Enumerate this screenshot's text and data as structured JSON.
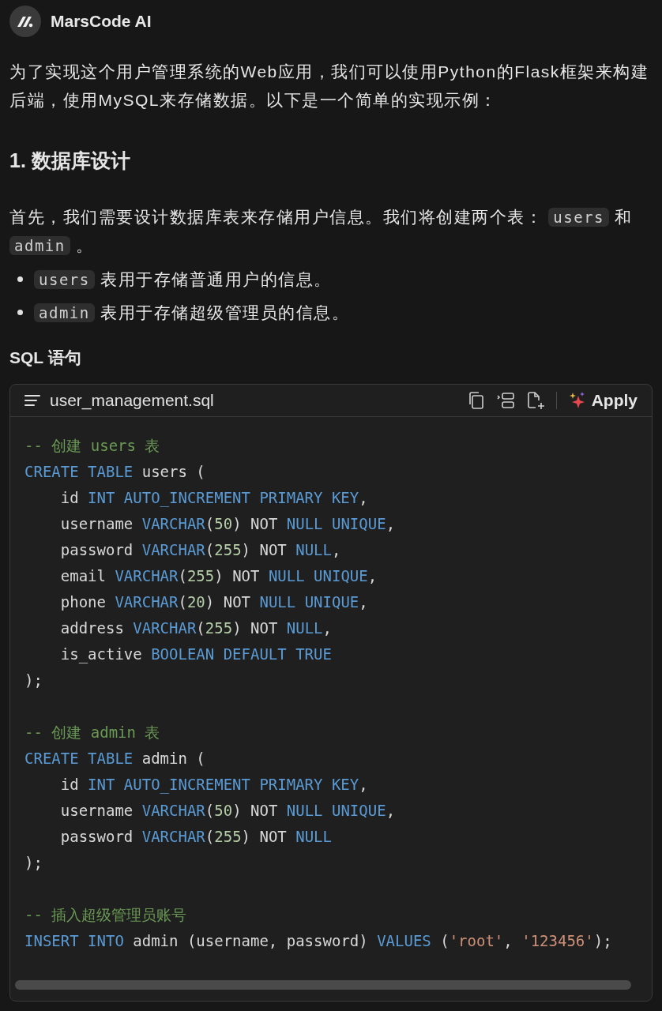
{
  "header": {
    "title": "MarsCode AI"
  },
  "intro": [
    {
      "kind": "text",
      "text": "为了实现这个用户管理系统的Web应用，我们可以使用Python的Flask框架来构建后端，使用MySQL来存储数据。以下是一个简单的实现示例："
    }
  ],
  "heading": "1. 数据库设计",
  "paragraph": [
    {
      "kind": "text",
      "text": "首先，我们需要设计数据库表来存储用户信息。我们将创建两个表： "
    },
    {
      "kind": "code",
      "text": "users"
    },
    {
      "kind": "text",
      "text": " 和 "
    },
    {
      "kind": "code",
      "text": "admin"
    },
    {
      "kind": "text",
      "text": " 。"
    }
  ],
  "bullets": [
    [
      {
        "kind": "code",
        "text": "users"
      },
      {
        "kind": "text",
        "text": " 表用于存储普通用户的信息。"
      }
    ],
    [
      {
        "kind": "code",
        "text": "admin"
      },
      {
        "kind": "text",
        "text": " 表用于存储超级管理员的信息。"
      }
    ]
  ],
  "subheading": "SQL 语句",
  "code_block": {
    "filename": "user_management.sql",
    "apply_label": "Apply",
    "sections": [
      [
        [
          {
            "kind": "comment",
            "text": "-- 创建 users 表"
          }
        ],
        [
          {
            "kind": "kw",
            "text": "CREATE TABLE"
          },
          {
            "kind": "plain",
            "text": " users ("
          }
        ],
        [
          {
            "kind": "plain",
            "text": "    id "
          },
          {
            "kind": "kw",
            "text": "INT AUTO_INCREMENT PRIMARY KEY"
          },
          {
            "kind": "plain",
            "text": ","
          }
        ],
        [
          {
            "kind": "plain",
            "text": "    username "
          },
          {
            "kind": "kw",
            "text": "VARCHAR"
          },
          {
            "kind": "plain",
            "text": "("
          },
          {
            "kind": "num",
            "text": "50"
          },
          {
            "kind": "plain",
            "text": ") NOT "
          },
          {
            "kind": "kw",
            "text": "NULL UNIQUE"
          },
          {
            "kind": "plain",
            "text": ","
          }
        ],
        [
          {
            "kind": "plain",
            "text": "    password "
          },
          {
            "kind": "kw",
            "text": "VARCHAR"
          },
          {
            "kind": "plain",
            "text": "("
          },
          {
            "kind": "num",
            "text": "255"
          },
          {
            "kind": "plain",
            "text": ") NOT "
          },
          {
            "kind": "kw",
            "text": "NULL"
          },
          {
            "kind": "plain",
            "text": ","
          }
        ],
        [
          {
            "kind": "plain",
            "text": "    email "
          },
          {
            "kind": "kw",
            "text": "VARCHAR"
          },
          {
            "kind": "plain",
            "text": "("
          },
          {
            "kind": "num",
            "text": "255"
          },
          {
            "kind": "plain",
            "text": ") NOT "
          },
          {
            "kind": "kw",
            "text": "NULL UNIQUE"
          },
          {
            "kind": "plain",
            "text": ","
          }
        ],
        [
          {
            "kind": "plain",
            "text": "    phone "
          },
          {
            "kind": "kw",
            "text": "VARCHAR"
          },
          {
            "kind": "plain",
            "text": "("
          },
          {
            "kind": "num",
            "text": "20"
          },
          {
            "kind": "plain",
            "text": ") NOT "
          },
          {
            "kind": "kw",
            "text": "NULL UNIQUE"
          },
          {
            "kind": "plain",
            "text": ","
          }
        ],
        [
          {
            "kind": "plain",
            "text": "    address "
          },
          {
            "kind": "kw",
            "text": "VARCHAR"
          },
          {
            "kind": "plain",
            "text": "("
          },
          {
            "kind": "num",
            "text": "255"
          },
          {
            "kind": "plain",
            "text": ") NOT "
          },
          {
            "kind": "kw",
            "text": "NULL"
          },
          {
            "kind": "plain",
            "text": ","
          }
        ],
        [
          {
            "kind": "plain",
            "text": "    is_active "
          },
          {
            "kind": "kw",
            "text": "BOOLEAN DEFAULT TRUE"
          }
        ],
        [
          {
            "kind": "plain",
            "text": ");"
          }
        ]
      ],
      [
        [
          {
            "kind": "comment",
            "text": "-- 创建 admin 表"
          }
        ],
        [
          {
            "kind": "kw",
            "text": "CREATE TABLE"
          },
          {
            "kind": "plain",
            "text": " admin ("
          }
        ],
        [
          {
            "kind": "plain",
            "text": "    id "
          },
          {
            "kind": "kw",
            "text": "INT AUTO_INCREMENT PRIMARY KEY"
          },
          {
            "kind": "plain",
            "text": ","
          }
        ],
        [
          {
            "kind": "plain",
            "text": "    username "
          },
          {
            "kind": "kw",
            "text": "VARCHAR"
          },
          {
            "kind": "plain",
            "text": "("
          },
          {
            "kind": "num",
            "text": "50"
          },
          {
            "kind": "plain",
            "text": ") NOT "
          },
          {
            "kind": "kw",
            "text": "NULL UNIQUE"
          },
          {
            "kind": "plain",
            "text": ","
          }
        ],
        [
          {
            "kind": "plain",
            "text": "    password "
          },
          {
            "kind": "kw",
            "text": "VARCHAR"
          },
          {
            "kind": "plain",
            "text": "("
          },
          {
            "kind": "num",
            "text": "255"
          },
          {
            "kind": "plain",
            "text": ") NOT "
          },
          {
            "kind": "kw",
            "text": "NULL"
          }
        ],
        [
          {
            "kind": "plain",
            "text": ");"
          }
        ]
      ],
      [
        [
          {
            "kind": "comment",
            "text": "-- 插入超级管理员账号"
          }
        ],
        [
          {
            "kind": "kw",
            "text": "INSERT INTO"
          },
          {
            "kind": "plain",
            "text": " admin (username, password) "
          },
          {
            "kind": "kw",
            "text": "VALUES"
          },
          {
            "kind": "plain",
            "text": " ("
          },
          {
            "kind": "str",
            "text": "'root'"
          },
          {
            "kind": "plain",
            "text": ", "
          },
          {
            "kind": "str",
            "text": "'123456'"
          },
          {
            "kind": "plain",
            "text": ");"
          }
        ]
      ]
    ]
  }
}
